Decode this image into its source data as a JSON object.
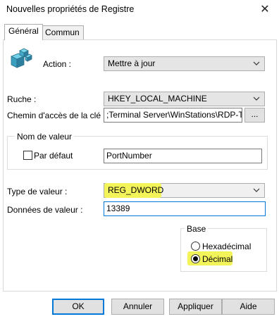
{
  "window": {
    "title": "Nouvelles propriétés de Registre",
    "close_glyph": "✕"
  },
  "tabs": [
    {
      "label": "Général",
      "active": true
    },
    {
      "label": "Commun",
      "active": false
    }
  ],
  "action": {
    "label": "Action :",
    "value": "Mettre à jour"
  },
  "hive": {
    "label": "Ruche :",
    "value": "HKEY_LOCAL_MACHINE"
  },
  "key_path": {
    "label": "Chemin d'accès de la clé :",
    "value": ";Terminal Server\\WinStations\\RDP-Tcp",
    "browse_label": "..."
  },
  "value_name": {
    "group_title": "Nom de valeur",
    "default_label": "Par défaut",
    "default_checked": false,
    "value": "PortNumber"
  },
  "value_type": {
    "label": "Type de valeur :",
    "value": "REG_DWORD"
  },
  "value_data": {
    "label": "Données de valeur :",
    "value": "13389"
  },
  "base": {
    "group_title": "Base",
    "options": [
      {
        "label": "Hexadécimal",
        "selected": false
      },
      {
        "label": "Décimal",
        "selected": true
      }
    ]
  },
  "buttons": {
    "ok": "OK",
    "cancel": "Annuler",
    "apply": "Appliquer",
    "help": "Aide"
  },
  "colors": {
    "highlight": "#f3f35a",
    "focus_border": "#0078d7"
  }
}
